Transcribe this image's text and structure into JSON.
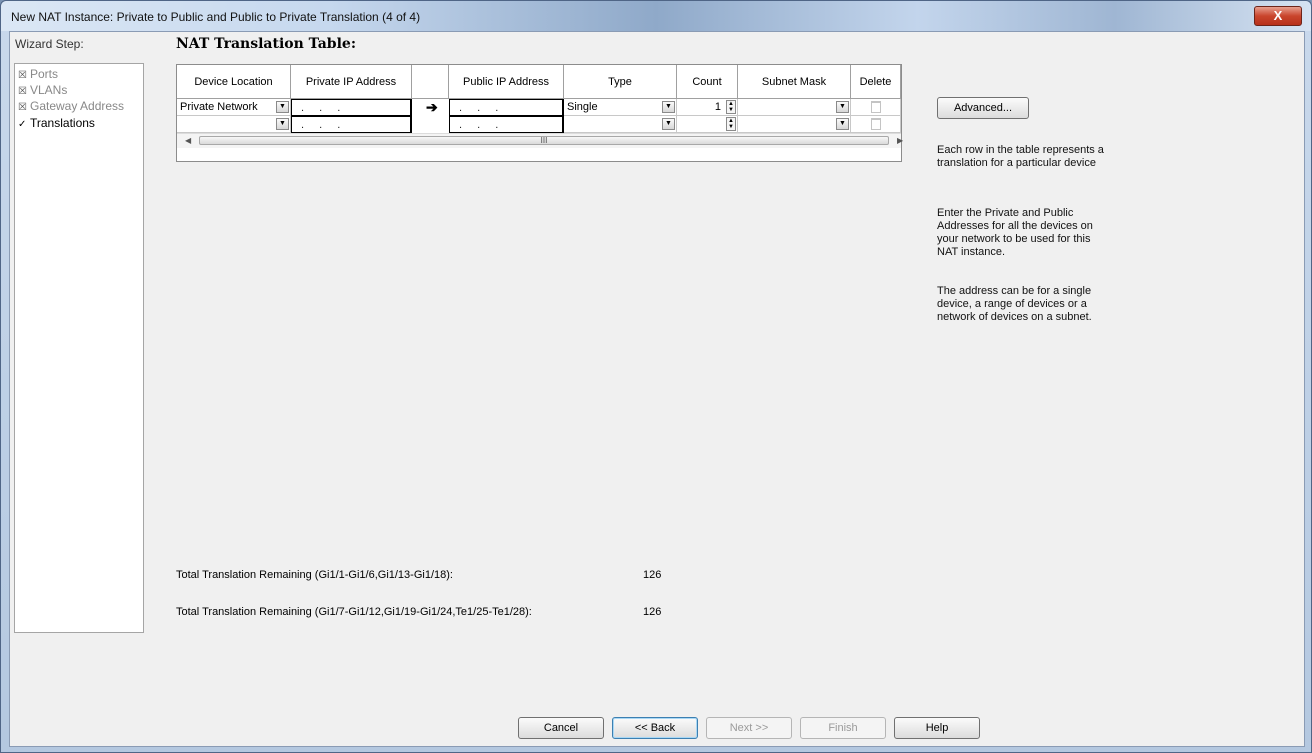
{
  "window": {
    "title": "New NAT Instance: Private to Public and Public to Private Translation (4 of 4)",
    "close_glyph": "X"
  },
  "wizard": {
    "label": "Wizard Step:",
    "steps": [
      {
        "label": "Ports",
        "state": "done",
        "mark": "☒"
      },
      {
        "label": "VLANs",
        "state": "done",
        "mark": "☒"
      },
      {
        "label": "Gateway Address",
        "state": "done",
        "mark": "☒"
      },
      {
        "label": "Translations",
        "state": "current",
        "mark": "✓"
      }
    ]
  },
  "table": {
    "title": "NAT Translation Table:",
    "columns": {
      "device_location": "Device Location",
      "private_ip": "Private IP Address",
      "public_ip": "Public IP Address",
      "type": "Type",
      "count": "Count",
      "subnet_mask": "Subnet Mask",
      "delete": "Delete"
    },
    "rows": [
      {
        "device_location": "Private Network",
        "private_ip": ". . .",
        "public_ip": ". . .",
        "type": "Single",
        "count": "1",
        "subnet_mask": ""
      },
      {
        "device_location": "",
        "private_ip": ". . .",
        "public_ip": ". . .",
        "type": "",
        "count": "",
        "subnet_mask": ""
      }
    ],
    "arrow_glyph": "➔",
    "scrollbar_grip": "III"
  },
  "side": {
    "advanced_button": "Advanced...",
    "help_1": "Each row in the table represents a translation for a particular device",
    "help_2": "Enter the Private and Public Addresses for all the devices on your network to be used for this NAT instance.",
    "help_3": "The address can be for a single device, a range of devices or a network of devices on a subnet."
  },
  "remaining": [
    {
      "label": "Total Translation Remaining (Gi1/1-Gi1/6,Gi1/13-Gi1/18):",
      "value": "126"
    },
    {
      "label": "Total Translation Remaining (Gi1/7-Gi1/12,Gi1/19-Gi1/24,Te1/25-Te1/28):",
      "value": "126"
    }
  ],
  "buttons": {
    "cancel": "Cancel",
    "back": "<< Back",
    "next": "Next >>",
    "finish": "Finish",
    "help": "Help"
  },
  "colors": {
    "title_bar": "#c6d8ee",
    "client_bg": "#f0f0f0",
    "close_button": "#c9452c"
  }
}
